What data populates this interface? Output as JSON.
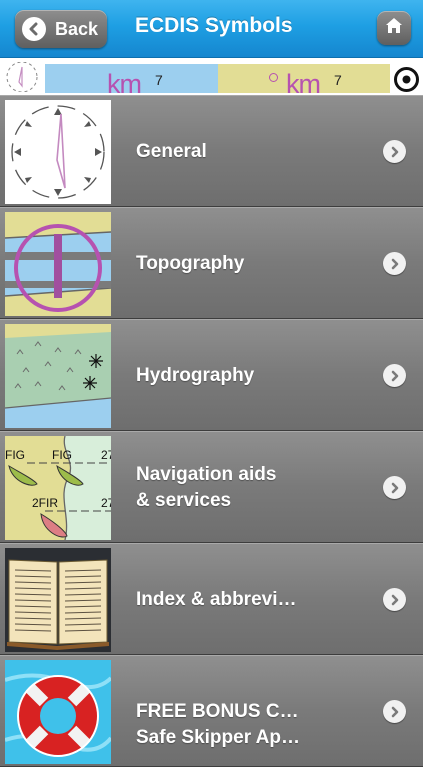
{
  "navbar": {
    "back_label": "Back",
    "title": "ECDIS Symbols",
    "home_icon": "home-icon"
  },
  "strip": {
    "left_unit": "km",
    "left_value": "7",
    "right_unit": "km",
    "right_value": "7"
  },
  "menu": [
    {
      "label": "General",
      "thumbnail": "compass-rose-icon"
    },
    {
      "label": "Topography",
      "thumbnail": "bridge-symbol-icon"
    },
    {
      "label": "Hydrography",
      "thumbnail": "reef-symbol-icon"
    },
    {
      "label": "Navigation aids\n& services",
      "labels_in_thumbnail": [
        "FIG",
        "FIG",
        "27",
        "2FIR",
        "27"
      ],
      "thumbnail": "light-symbol-icon"
    },
    {
      "label": "Index & abbrevi…",
      "thumbnail": "open-book-icon"
    },
    {
      "label": "FREE BONUS C…\nSafe Skipper Ap…",
      "thumbnail": "lifebuoy-icon"
    }
  ],
  "colors": {
    "navbar": "#1e9fe3",
    "row": "#7a7a7a",
    "chart_blue": "#9ccfef",
    "chart_tan": "#e2dd95",
    "magenta": "#b652b0"
  }
}
